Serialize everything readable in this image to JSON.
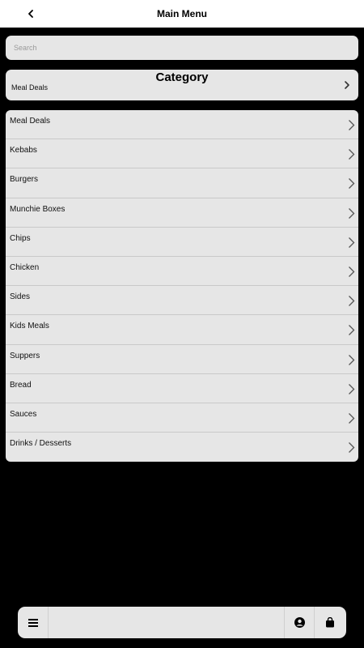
{
  "header": {
    "title": "Main Menu",
    "back_icon": "chevron-left-icon"
  },
  "search": {
    "placeholder": "Search",
    "value": ""
  },
  "category": {
    "title": "Category",
    "selected": "Meal Deals",
    "icon": "chevron-right-icon"
  },
  "menu": {
    "items": [
      {
        "label": "Meal Deals"
      },
      {
        "label": "Kebabs"
      },
      {
        "label": "Burgers"
      },
      {
        "label": "Munchie Boxes"
      },
      {
        "label": "Chips"
      },
      {
        "label": "Chicken"
      },
      {
        "label": "Sides"
      },
      {
        "label": "Kids Meals"
      },
      {
        "label": "Suppers"
      },
      {
        "label": "Bread"
      },
      {
        "label": "Sauces"
      },
      {
        "label": "Drinks / Desserts"
      }
    ]
  },
  "bottom_bar": {
    "menu_icon": "hamburger-menu-icon",
    "account_icon": "user-account-icon",
    "bag_icon": "shopping-bag-icon"
  },
  "colors": {
    "background": "#000000",
    "card": "#e6e6e6",
    "header": "#ffffff",
    "text": "#111111"
  }
}
